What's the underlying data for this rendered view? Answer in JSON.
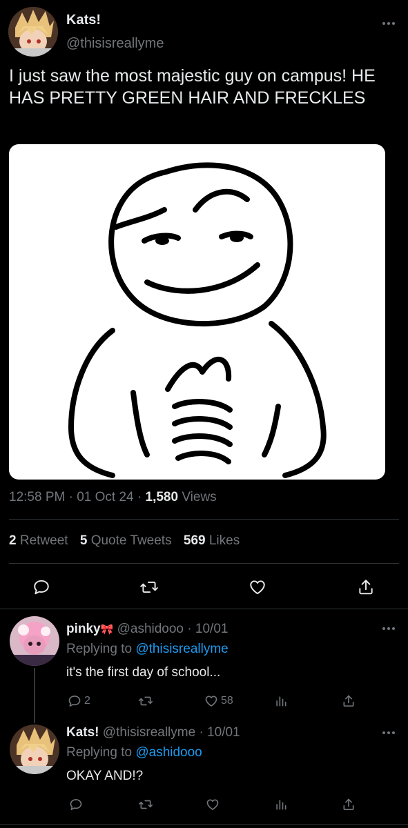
{
  "tweet": {
    "author": {
      "name": "Kats!",
      "handle": "@thisisreallyme"
    },
    "text": "I just saw the most majestic guy on campus! HE HAS PRETTY GREEN HAIR AND FRECKLES",
    "meta": {
      "time": "12:58 PM",
      "date": "01 Oct 24",
      "views_count": "1,580",
      "views_label": "Views",
      "separator": "·"
    },
    "stats": {
      "retweets_count": "2",
      "retweets_label": "Retweet",
      "quotes_count": "5",
      "quotes_label": "Quote Tweets",
      "likes_count": "569",
      "likes_label": "Likes"
    }
  },
  "replies": [
    {
      "name": "pinky",
      "name_emoji": "🎀",
      "handle": "@ashidooo",
      "date": "· 10/01",
      "replying_prefix": "Replying to",
      "replying_to": "@thisisreallyme",
      "text": "it's the first day of school...",
      "replies_count": "2",
      "likes_count": "58"
    },
    {
      "name": "Kats!",
      "handle": "@thisisreallyme",
      "date": "· 10/01",
      "replying_prefix": "Replying to",
      "replying_to": "@ashidooo",
      "text": "OKAY AND!?"
    }
  ],
  "icons": {
    "more": "more-dots-icon",
    "reply": "reply-bubble-icon",
    "retweet": "retweet-icon",
    "like": "heart-icon",
    "share": "share-icon",
    "analytics": "analytics-icon"
  },
  "colors": {
    "background": "#000000",
    "text": "#e7e9ea",
    "muted": "#71767b",
    "link": "#1d9bf0",
    "divider": "#2f3336"
  }
}
